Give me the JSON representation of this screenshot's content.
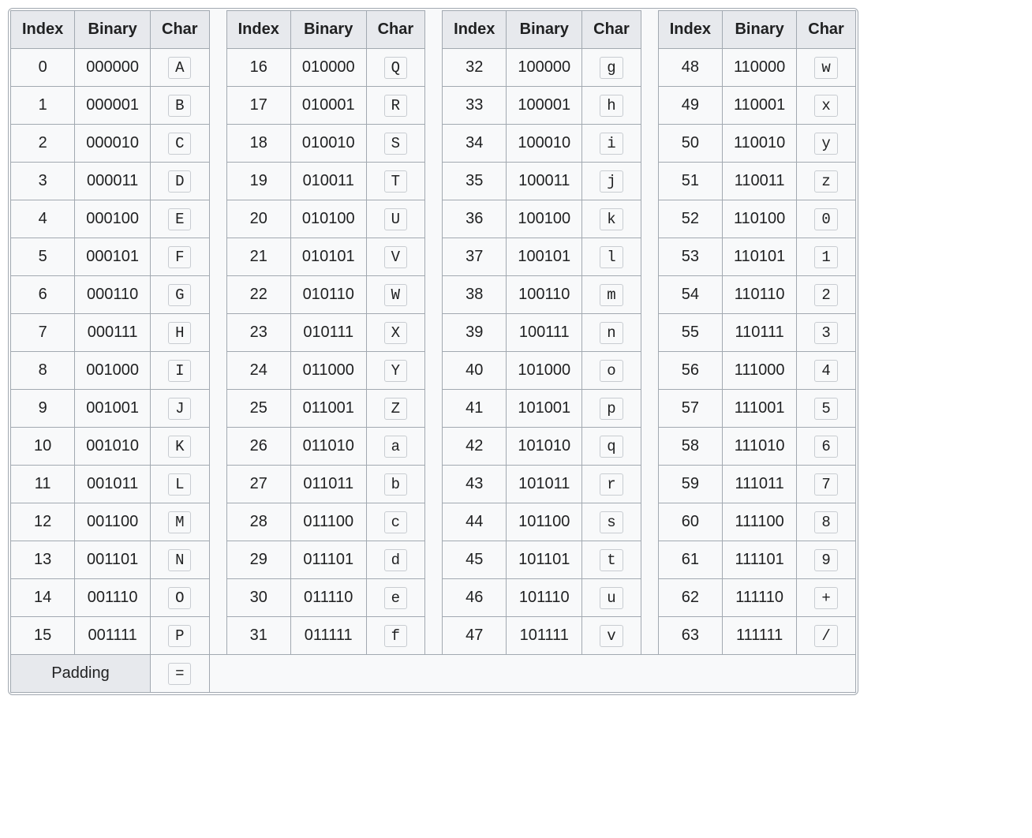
{
  "headers": {
    "index": "Index",
    "binary": "Binary",
    "char": "Char"
  },
  "padding": {
    "label": "Padding",
    "char": "="
  },
  "groups": [
    [
      {
        "index": "0",
        "binary": "000000",
        "char": "A"
      },
      {
        "index": "1",
        "binary": "000001",
        "char": "B"
      },
      {
        "index": "2",
        "binary": "000010",
        "char": "C"
      },
      {
        "index": "3",
        "binary": "000011",
        "char": "D"
      },
      {
        "index": "4",
        "binary": "000100",
        "char": "E"
      },
      {
        "index": "5",
        "binary": "000101",
        "char": "F"
      },
      {
        "index": "6",
        "binary": "000110",
        "char": "G"
      },
      {
        "index": "7",
        "binary": "000111",
        "char": "H"
      },
      {
        "index": "8",
        "binary": "001000",
        "char": "I"
      },
      {
        "index": "9",
        "binary": "001001",
        "char": "J"
      },
      {
        "index": "10",
        "binary": "001010",
        "char": "K"
      },
      {
        "index": "11",
        "binary": "001011",
        "char": "L"
      },
      {
        "index": "12",
        "binary": "001100",
        "char": "M"
      },
      {
        "index": "13",
        "binary": "001101",
        "char": "N"
      },
      {
        "index": "14",
        "binary": "001110",
        "char": "O"
      },
      {
        "index": "15",
        "binary": "001111",
        "char": "P"
      }
    ],
    [
      {
        "index": "16",
        "binary": "010000",
        "char": "Q"
      },
      {
        "index": "17",
        "binary": "010001",
        "char": "R"
      },
      {
        "index": "18",
        "binary": "010010",
        "char": "S"
      },
      {
        "index": "19",
        "binary": "010011",
        "char": "T"
      },
      {
        "index": "20",
        "binary": "010100",
        "char": "U"
      },
      {
        "index": "21",
        "binary": "010101",
        "char": "V"
      },
      {
        "index": "22",
        "binary": "010110",
        "char": "W"
      },
      {
        "index": "23",
        "binary": "010111",
        "char": "X"
      },
      {
        "index": "24",
        "binary": "011000",
        "char": "Y"
      },
      {
        "index": "25",
        "binary": "011001",
        "char": "Z"
      },
      {
        "index": "26",
        "binary": "011010",
        "char": "a"
      },
      {
        "index": "27",
        "binary": "011011",
        "char": "b"
      },
      {
        "index": "28",
        "binary": "011100",
        "char": "c"
      },
      {
        "index": "29",
        "binary": "011101",
        "char": "d"
      },
      {
        "index": "30",
        "binary": "011110",
        "char": "e"
      },
      {
        "index": "31",
        "binary": "011111",
        "char": "f"
      }
    ],
    [
      {
        "index": "32",
        "binary": "100000",
        "char": "g"
      },
      {
        "index": "33",
        "binary": "100001",
        "char": "h"
      },
      {
        "index": "34",
        "binary": "100010",
        "char": "i"
      },
      {
        "index": "35",
        "binary": "100011",
        "char": "j"
      },
      {
        "index": "36",
        "binary": "100100",
        "char": "k"
      },
      {
        "index": "37",
        "binary": "100101",
        "char": "l"
      },
      {
        "index": "38",
        "binary": "100110",
        "char": "m"
      },
      {
        "index": "39",
        "binary": "100111",
        "char": "n"
      },
      {
        "index": "40",
        "binary": "101000",
        "char": "o"
      },
      {
        "index": "41",
        "binary": "101001",
        "char": "p"
      },
      {
        "index": "42",
        "binary": "101010",
        "char": "q"
      },
      {
        "index": "43",
        "binary": "101011",
        "char": "r"
      },
      {
        "index": "44",
        "binary": "101100",
        "char": "s"
      },
      {
        "index": "45",
        "binary": "101101",
        "char": "t"
      },
      {
        "index": "46",
        "binary": "101110",
        "char": "u"
      },
      {
        "index": "47",
        "binary": "101111",
        "char": "v"
      }
    ],
    [
      {
        "index": "48",
        "binary": "110000",
        "char": "w"
      },
      {
        "index": "49",
        "binary": "110001",
        "char": "x"
      },
      {
        "index": "50",
        "binary": "110010",
        "char": "y"
      },
      {
        "index": "51",
        "binary": "110011",
        "char": "z"
      },
      {
        "index": "52",
        "binary": "110100",
        "char": "0"
      },
      {
        "index": "53",
        "binary": "110101",
        "char": "1"
      },
      {
        "index": "54",
        "binary": "110110",
        "char": "2"
      },
      {
        "index": "55",
        "binary": "110111",
        "char": "3"
      },
      {
        "index": "56",
        "binary": "111000",
        "char": "4"
      },
      {
        "index": "57",
        "binary": "111001",
        "char": "5"
      },
      {
        "index": "58",
        "binary": "111010",
        "char": "6"
      },
      {
        "index": "59",
        "binary": "111011",
        "char": "7"
      },
      {
        "index": "60",
        "binary": "111100",
        "char": "8"
      },
      {
        "index": "61",
        "binary": "111101",
        "char": "9"
      },
      {
        "index": "62",
        "binary": "111110",
        "char": "+"
      },
      {
        "index": "63",
        "binary": "111111",
        "char": "/"
      }
    ]
  ]
}
